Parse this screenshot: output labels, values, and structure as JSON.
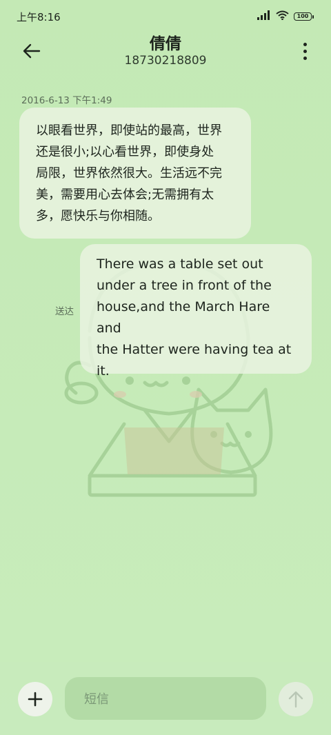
{
  "status_bar": {
    "time": "上午8:16",
    "battery": "100"
  },
  "header": {
    "contact_name": "倩倩",
    "phone_number": "18730218809"
  },
  "messages": {
    "timestamp": "2016-6-13 下午1:49",
    "incoming": [
      "以眼看世界，即使站的最高，世界",
      "还是很小;以心看世界，即使身处",
      "局限，世界依然很大。生活远不完",
      "美，需要用心去体会;无需拥有太",
      "多，愿快乐与你相随。"
    ],
    "outgoing": [
      "There was a table set out",
      "under a tree in front of the",
      "house,and the March Hare and",
      "the Hatter were having tea at",
      "it."
    ],
    "status_label": "送达"
  },
  "composer": {
    "placeholder": "短信"
  },
  "icons": {
    "back": "back-arrow-icon",
    "more": "more-vertical-icon",
    "add": "plus-icon",
    "send": "send-arrow-icon",
    "signal": "signal-icon",
    "wifi": "wifi-icon",
    "battery": "battery-icon"
  },
  "colors": {
    "background": "#c6ebb9",
    "bubble": "#e9f3e0",
    "input": "#b3dba6",
    "text": "#1d241d",
    "muted": "#5b6d59"
  }
}
